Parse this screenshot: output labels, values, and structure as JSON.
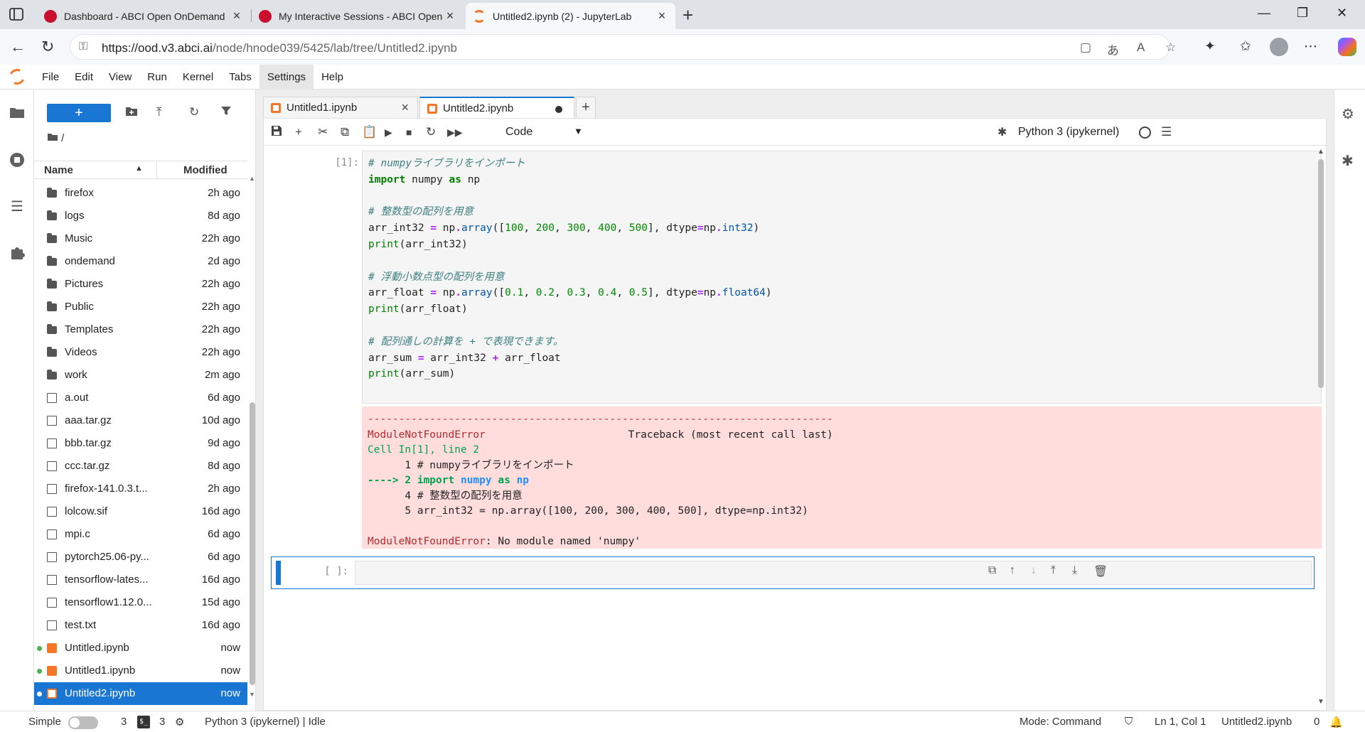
{
  "browser": {
    "tabs": [
      {
        "title": "Dashboard - ABCI Open OnDemand",
        "favicon_color": "#c8102e"
      },
      {
        "title": "My Interactive Sessions - ABCI Open OnDemand",
        "favicon_color": "#c8102e"
      },
      {
        "title": "Untitled2.ipynb (2) - JupyterLab",
        "favicon_color": "#f37726"
      }
    ],
    "url_host": "https://ood.v3.abci.ai",
    "url_path": "/node/hnode039/5425/lab/tree/Untitled2.ipynb"
  },
  "jupyter": {
    "menu": [
      "File",
      "Edit",
      "View",
      "Run",
      "Kernel",
      "Tabs",
      "Settings",
      "Help"
    ],
    "file_browser": {
      "new_label": "+",
      "breadcrumb": "/",
      "col_name": "Name",
      "col_modified": "Modified",
      "files": [
        {
          "name": "firefox",
          "modified": "2h ago",
          "type": "folder"
        },
        {
          "name": "logs",
          "modified": "8d ago",
          "type": "folder"
        },
        {
          "name": "Music",
          "modified": "22h ago",
          "type": "folder"
        },
        {
          "name": "ondemand",
          "modified": "2d ago",
          "type": "folder"
        },
        {
          "name": "Pictures",
          "modified": "22h ago",
          "type": "folder"
        },
        {
          "name": "Public",
          "modified": "22h ago",
          "type": "folder"
        },
        {
          "name": "Templates",
          "modified": "22h ago",
          "type": "folder"
        },
        {
          "name": "Videos",
          "modified": "22h ago",
          "type": "folder"
        },
        {
          "name": "work",
          "modified": "2m ago",
          "type": "folder"
        },
        {
          "name": "a.out",
          "modified": "6d ago",
          "type": "file"
        },
        {
          "name": "aaa.tar.gz",
          "modified": "10d ago",
          "type": "file"
        },
        {
          "name": "bbb.tar.gz",
          "modified": "9d ago",
          "type": "file"
        },
        {
          "name": "ccc.tar.gz",
          "modified": "8d ago",
          "type": "file"
        },
        {
          "name": "firefox-141.0.3.t...",
          "modified": "2h ago",
          "type": "file"
        },
        {
          "name": "lolcow.sif",
          "modified": "16d ago",
          "type": "file"
        },
        {
          "name": "mpi.c",
          "modified": "6d ago",
          "type": "file"
        },
        {
          "name": "pytorch25.06-py...",
          "modified": "6d ago",
          "type": "file"
        },
        {
          "name": "tensorflow-lates...",
          "modified": "16d ago",
          "type": "file"
        },
        {
          "name": "tensorflow1.12.0...",
          "modified": "15d ago",
          "type": "file"
        },
        {
          "name": "test.txt",
          "modified": "16d ago",
          "type": "file"
        },
        {
          "name": "Untitled.ipynb",
          "modified": "now",
          "type": "notebook",
          "running": true
        },
        {
          "name": "Untitled1.ipynb",
          "modified": "now",
          "type": "notebook",
          "running": true
        },
        {
          "name": "Untitled2.ipynb",
          "modified": "now",
          "type": "notebook",
          "running": true,
          "selected": true
        }
      ]
    },
    "doc_tabs": [
      {
        "label": "Untitled1.ipynb"
      },
      {
        "label": "Untitled2.ipynb"
      }
    ],
    "notebook": {
      "cell_type": "Code",
      "kernel": "Python 3 (ipykernel)",
      "cell1_prompt": "[1]:",
      "cell2_prompt": "[ ]:"
    },
    "statusbar": {
      "simple": "Simple",
      "terminals": "3",
      "kernels": "3",
      "kernel_status": "Python 3 (ipykernel) | Idle",
      "mode": "Mode: Command",
      "position": "Ln 1, Col 1",
      "filename": "Untitled2.ipynb",
      "notifications": "0"
    }
  },
  "code": {
    "c1": "# numpyライブラリをインポート",
    "c2": "# 整数型の配列を用意",
    "c3": "# 浮動小数点型の配列を用意",
    "c4": "# 配列通しの計算を + で表現できます。"
  },
  "error": {
    "dashes": "---------------------------------------------------------------------------",
    "name": "ModuleNotFoundError",
    "traceback": "Traceback (most recent call last)",
    "cell": "Cell In[1], line 2",
    "line1": "      1 # numpyライブラリをインポート",
    "line4": "      4 # 整数型の配列を用意",
    "line5": "      5 arr_int32 = np.array([100, 200, 300, 400, 500], dtype=np.int32)",
    "message": ": No module named 'numpy'"
  }
}
